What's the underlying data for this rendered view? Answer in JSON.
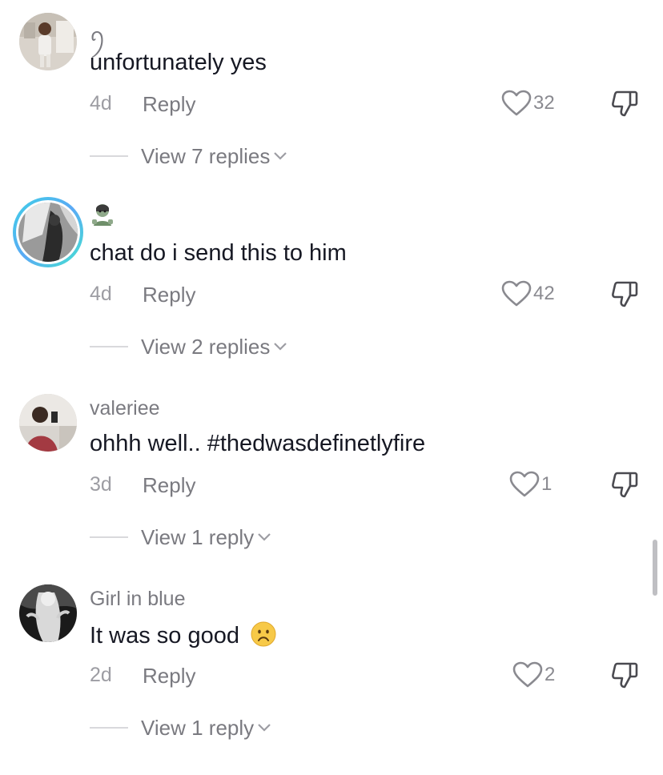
{
  "comments": [
    {
      "username": "ꪆ",
      "text": "unfortunately yes",
      "date": "4d",
      "reply_label": "Reply",
      "likes": "32",
      "view_replies": "View 7 replies"
    },
    {
      "username_icon": "zombie-emoji",
      "text": "chat do i send this to him",
      "date": "4d",
      "reply_label": "Reply",
      "likes": "42",
      "view_replies": "View 2 replies"
    },
    {
      "username": "valeriee",
      "text": "ohhh well.. #thedwasdefinetlyfire",
      "date": "3d",
      "reply_label": "Reply",
      "likes": "1",
      "view_replies": "View 1 reply"
    },
    {
      "username": "Girl in blue",
      "text": "It was so good",
      "text_emoji": "sad-face-emoji",
      "date": "2d",
      "reply_label": "Reply",
      "likes": "2",
      "view_replies": "View 1 reply"
    }
  ],
  "colors": {
    "primary_text": "#161823",
    "secondary_text": "#7a7a80",
    "divider": "#d9d9dc",
    "story_ring": "#3fd0e6"
  }
}
